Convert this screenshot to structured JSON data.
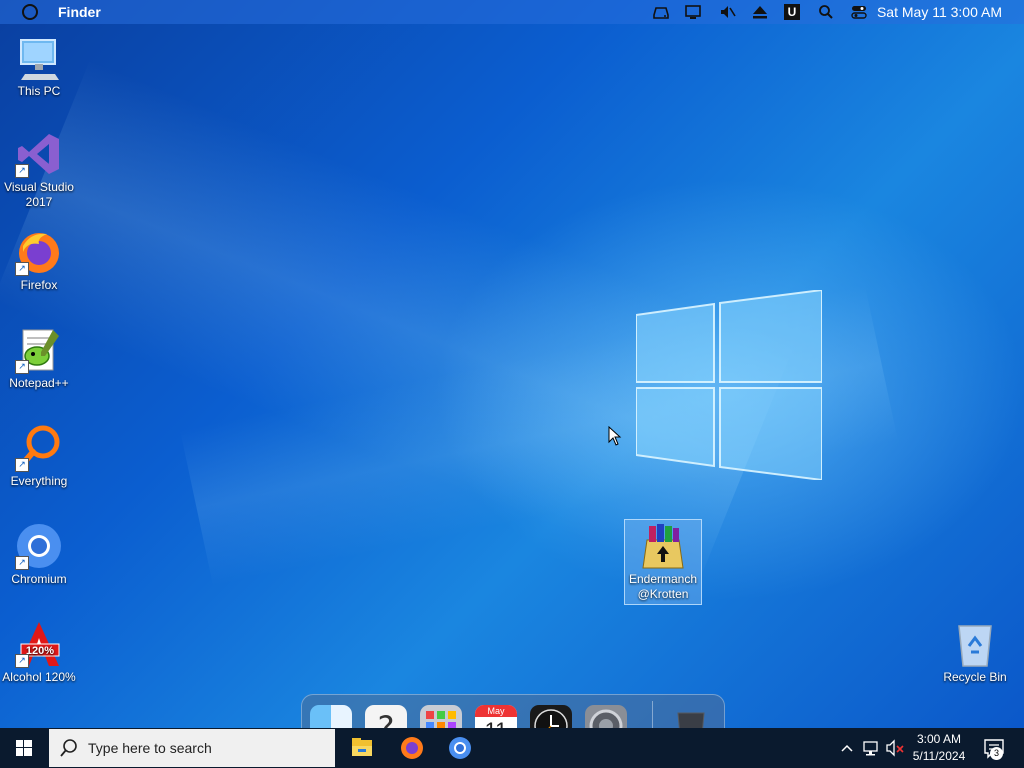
{
  "menubar": {
    "app_name": "Finder",
    "datetime": "Sat May 11 3:00 AM",
    "icons": [
      "drive-icon",
      "monitor-icon",
      "mute-icon",
      "eject-icon",
      "u-icon",
      "search-icon",
      "control-center-icon"
    ]
  },
  "desktop_icons": [
    {
      "label": "This PC"
    },
    {
      "label": "Visual Studio 2017"
    },
    {
      "label": "Firefox"
    },
    {
      "label": "Notepad++"
    },
    {
      "label": "Everything"
    },
    {
      "label": "Chromium"
    },
    {
      "label": "Alcohol 120%"
    },
    {
      "label": "Endermanch @Krotten"
    },
    {
      "label": "Recycle Bin"
    }
  ],
  "dock": {
    "calendar_month": "May",
    "calendar_day": "11",
    "items": [
      "finder-icon",
      "help-icon",
      "launchpad-icon",
      "calendar-icon",
      "clock-icon",
      "system-preferences-icon",
      "trash-icon"
    ]
  },
  "taskbar": {
    "search_placeholder": "Type here to search",
    "time": "3:00 AM",
    "date": "5/11/2024",
    "notification_count": "3"
  },
  "colors": {
    "taskbar": "#0a1a2e",
    "wallpaper_primary": "#0b5ed0",
    "menubar": "#2a6ed8"
  }
}
